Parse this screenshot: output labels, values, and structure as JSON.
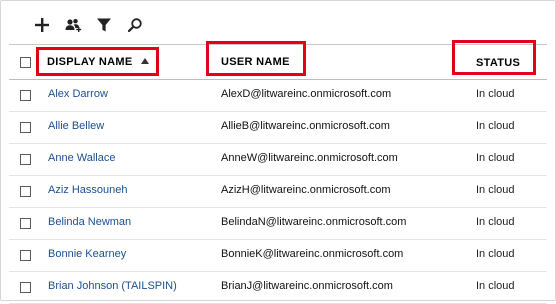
{
  "toolbar": {
    "buttons": [
      {
        "name": "add-icon",
        "title": "Add"
      },
      {
        "name": "multiple-users-icon",
        "title": "Multiple users"
      },
      {
        "name": "filter-icon",
        "title": "Filter"
      },
      {
        "name": "search-icon",
        "title": "Search"
      }
    ]
  },
  "table": {
    "columns": {
      "display_name": "DISPLAY NAME",
      "user_name": "USER NAME",
      "status": "STATUS"
    },
    "sort": {
      "column": "display_name",
      "direction": "ascending"
    },
    "rows": [
      {
        "display_name": "Alex Darrow",
        "user_name": "AlexD@litwareinc.onmicrosoft.com",
        "status": "In cloud"
      },
      {
        "display_name": "Allie Bellew",
        "user_name": "AllieB@litwareinc.onmicrosoft.com",
        "status": "In cloud"
      },
      {
        "display_name": "Anne Wallace",
        "user_name": "AnneW@litwareinc.onmicrosoft.com",
        "status": "In cloud"
      },
      {
        "display_name": "Aziz Hassouneh",
        "user_name": "AzizH@litwareinc.onmicrosoft.com",
        "status": "In cloud"
      },
      {
        "display_name": "Belinda Newman",
        "user_name": "BelindaN@litwareinc.onmicrosoft.com",
        "status": "In cloud"
      },
      {
        "display_name": "Bonnie Kearney",
        "user_name": "BonnieK@litwareinc.onmicrosoft.com",
        "status": "In cloud"
      },
      {
        "display_name": "Brian Johnson (TAILSPIN)",
        "user_name": "BrianJ@litwareinc.onmicrosoft.com",
        "status": "In cloud"
      }
    ]
  },
  "colors": {
    "link": "#1d4f91",
    "highlight": "#e3001b"
  }
}
